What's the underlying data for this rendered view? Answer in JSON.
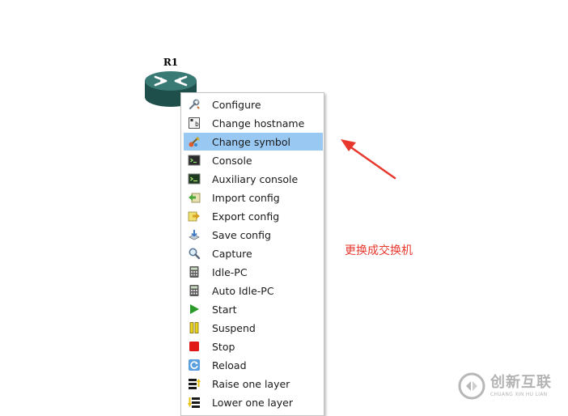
{
  "router": {
    "name": "R1",
    "color": "#2f6b66"
  },
  "menu": {
    "selected_index": 2,
    "items": [
      {
        "label": "Configure",
        "icon": "wrench-icon"
      },
      {
        "label": "Change hostname",
        "icon": "hostname-icon"
      },
      {
        "label": "Change symbol",
        "icon": "change-symbol-icon"
      },
      {
        "label": "Console",
        "icon": "console-icon"
      },
      {
        "label": "Auxiliary console",
        "icon": "auxiliary-console-icon"
      },
      {
        "label": "Import config",
        "icon": "import-config-icon"
      },
      {
        "label": "Export config",
        "icon": "export-config-icon"
      },
      {
        "label": "Save config",
        "icon": "save-config-icon"
      },
      {
        "label": "Capture",
        "icon": "magnifier-icon"
      },
      {
        "label": "Idle-PC",
        "icon": "calculator-icon"
      },
      {
        "label": "Auto Idle-PC",
        "icon": "calculator-icon"
      },
      {
        "label": "Start",
        "icon": "play-icon"
      },
      {
        "label": "Suspend",
        "icon": "pause-icon"
      },
      {
        "label": "Stop",
        "icon": "stop-icon"
      },
      {
        "label": "Reload",
        "icon": "reload-icon"
      },
      {
        "label": "Raise one layer",
        "icon": "raise-layer-icon"
      },
      {
        "label": "Lower one layer",
        "icon": "lower-layer-icon"
      }
    ]
  },
  "annotation": {
    "text": "更换成交换机",
    "color": "#e8382e"
  },
  "watermark": {
    "brand": "创新互联",
    "sub": "CHUANG XIN HU LIAN"
  },
  "colors": {
    "selection": "#99c9f2",
    "menu_border": "#c4c4c4"
  }
}
